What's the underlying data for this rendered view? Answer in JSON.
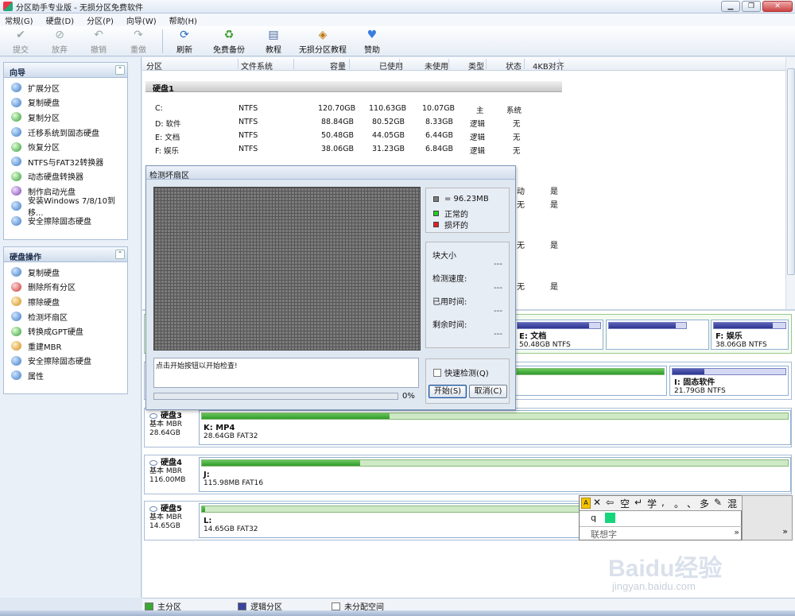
{
  "window": {
    "title": "分区助手专业版 - 无损分区免费软件"
  },
  "menu": [
    "常规(G)",
    "硬盘(D)",
    "分区(P)",
    "向导(W)",
    "帮助(H)"
  ],
  "toolbar": {
    "commit": "提交",
    "discard": "放弃",
    "undo": "撤销",
    "redo": "重做",
    "refresh": "刷新",
    "backup": "免费备份",
    "tutorial": "教程",
    "lossless_tutorial": "无损分区教程",
    "donate": "赞助"
  },
  "left": {
    "wizard_title": "向导",
    "wizard_items": [
      "扩展分区",
      "复制硬盘",
      "复制分区",
      "迁移系统到固态硬盘",
      "恢复分区",
      "NTFS与FAT32转换器",
      "动态硬盘转换器",
      "制作启动光盘",
      "安装Windows 7/8/10到移...",
      "安全擦除固态硬盘"
    ],
    "diskops_title": "硬盘操作",
    "diskops_items": [
      "复制硬盘",
      "删除所有分区",
      "擦除硬盘",
      "检测坏扇区",
      "转换成GPT硬盘",
      "重建MBR",
      "安全擦除固态硬盘",
      "属性"
    ]
  },
  "columns": [
    "分区",
    "文件系统",
    "容量",
    "已使用",
    "未使用",
    "类型",
    "状态",
    "4KB对齐"
  ],
  "disk1": {
    "label": "硬盘1",
    "rows": [
      {
        "name": "C:",
        "fs": "NTFS",
        "cap": "120.70GB",
        "used": "110.63GB",
        "free": "10.07GB",
        "type": "主",
        "status": "系统"
      },
      {
        "name": "D: 软件",
        "fs": "NTFS",
        "cap": "88.84GB",
        "used": "80.52GB",
        "free": "8.33GB",
        "type": "逻辑",
        "status": "无"
      },
      {
        "name": "E: 文档",
        "fs": "NTFS",
        "cap": "50.48GB",
        "used": "44.05GB",
        "free": "6.44GB",
        "type": "逻辑",
        "status": "无"
      },
      {
        "name": "F: 娱乐",
        "fs": "NTFS",
        "cap": "38.06GB",
        "used": "31.23GB",
        "free": "6.84GB",
        "type": "逻辑",
        "status": "无"
      }
    ]
  },
  "hidden_rows": [
    {
      "status": "动",
      "align": "是"
    },
    {
      "status": "无",
      "align": "是"
    },
    {
      "status": "无",
      "align": "是"
    },
    {
      "status": "无",
      "align": "是"
    }
  ],
  "diskmap": {
    "disk1_parts": [
      {
        "label": "E: 文档",
        "sub": "50.48GB NTFS",
        "fill": 0.87
      },
      {
        "label": "F: 娱乐",
        "sub": "38.06GB NTFS",
        "fill": 0.82
      }
    ],
    "disk2_parts": [
      {
        "label": "I: 固态软件",
        "sub": "21.79GB NTFS",
        "fill": 0.28
      }
    ],
    "disk3": {
      "name": "硬盘3",
      "type": "基本 MBR",
      "size": "28.64GB",
      "part": "K: MP4",
      "sub": "28.64GB FAT32",
      "fill": 0.32
    },
    "disk4": {
      "name": "硬盘4",
      "type": "基本 MBR",
      "size": "116.00MB",
      "part": "J:",
      "sub": "115.98MB FAT16",
      "fill": 0.27
    },
    "disk5": {
      "name": "硬盘5",
      "type": "基本 MBR",
      "size": "14.65GB",
      "part": "L:",
      "sub": "14.65GB FAT32",
      "fill": 0.005
    }
  },
  "legend": {
    "primary": "主分区",
    "logical": "逻辑分区",
    "unallocated": "未分配空间"
  },
  "dialog": {
    "title": "检测坏扇区",
    "legend_block": "= 96.23MB",
    "legend_ok": "正常的",
    "legend_bad": "损坏的",
    "block_size": "块大小",
    "speed": "检测速度:",
    "elapsed": "已用时间:",
    "remaining": "剩余时间:",
    "dash": "---",
    "message": "点击开始按钮以开始检查!",
    "progress_text": "0%",
    "progress": 0,
    "quick_check": "快速检测(Q)",
    "start": "开始(S)",
    "cancel": "取消(C)"
  },
  "ime": {
    "buttons": [
      "✕",
      "⇦",
      "空",
      "↵",
      "学",
      ",",
      "。",
      "、",
      "多",
      "✎",
      "混"
    ],
    "input": "q",
    "hint": "联想字",
    "more": "»"
  },
  "watermark": {
    "logo": "Baidu经验",
    "url": "jingyan.baidu.com"
  },
  "colors": {
    "primary_part": "#3aa832",
    "logical_part": "#3a43a0",
    "bad": "#d22",
    "ok": "#2d2"
  }
}
